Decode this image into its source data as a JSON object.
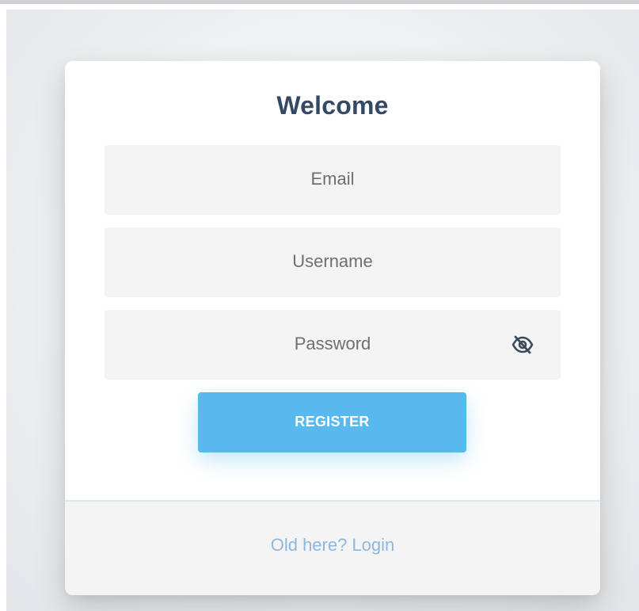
{
  "card": {
    "title": "Welcome"
  },
  "form": {
    "email_placeholder": "Email",
    "username_placeholder": "Username",
    "password_placeholder": "Password",
    "password_toggle_icon": "eye-off-icon",
    "register_label": "REGISTER"
  },
  "footer": {
    "login_link": "Old here? Login"
  },
  "colors": {
    "title": "#354866",
    "button": "#58b9ee",
    "link": "#8fb6de",
    "field_bg": "#f4f4f5"
  }
}
